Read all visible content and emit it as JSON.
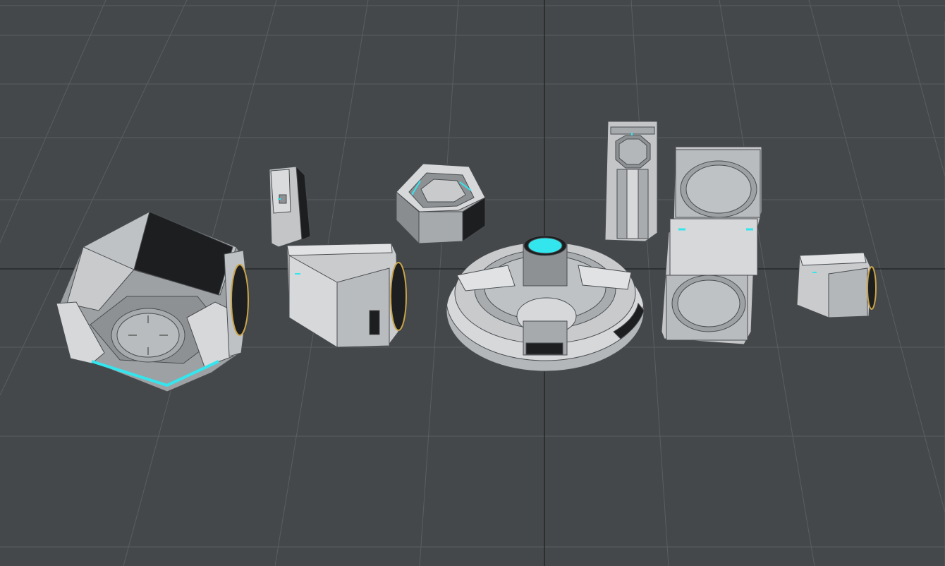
{
  "viewport": {
    "background": "#45484b",
    "grid_color": "#5b5e61",
    "axis_color": "#1f2123"
  },
  "scene": {
    "surface_light": "#d6d8da",
    "surface_mid": "#a9acaf",
    "surface_dark": "#1d1e20",
    "wire": "#4a4d50",
    "emissive": "#33e6ee",
    "brass": "#c9a449",
    "objects": [
      {
        "name": "hexagonal-pod"
      },
      {
        "name": "small-bracket"
      },
      {
        "name": "corner-hatch-block"
      },
      {
        "name": "hexagonal-ring"
      },
      {
        "name": "circular-landing-pad"
      },
      {
        "name": "elevator-shaft"
      },
      {
        "name": "stacked-hatch-tower"
      },
      {
        "name": "small-hatch-block"
      }
    ]
  }
}
